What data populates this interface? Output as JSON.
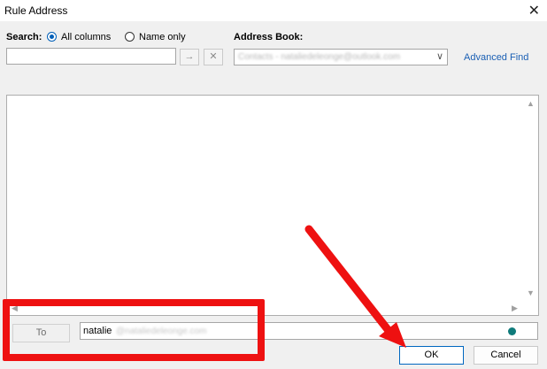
{
  "window": {
    "title": "Rule Address",
    "close_glyph": "✕"
  },
  "search": {
    "label": "Search:",
    "option_all": "All columns",
    "option_name": "Name only",
    "selected": "All columns",
    "value": "",
    "go_glyph": "→",
    "clear_glyph": "✕"
  },
  "address_book": {
    "label": "Address Book:",
    "selected": "Contacts - nataliedeleonge@outlook.com",
    "arrow_glyph": "∨"
  },
  "advanced_find": "Advanced Find",
  "to": {
    "button_label": "To",
    "value": "natalie",
    "value_redacted": "@nataliedeleonge.com"
  },
  "buttons": {
    "ok": "OK",
    "cancel": "Cancel"
  },
  "scroll_glyphs": {
    "up": "▲",
    "down": "▼",
    "left": "◀",
    "right": "▶"
  },
  "colors": {
    "annotation": "#ee1111",
    "link": "#1a5fb4",
    "status_dot": "#0f7b7b"
  }
}
